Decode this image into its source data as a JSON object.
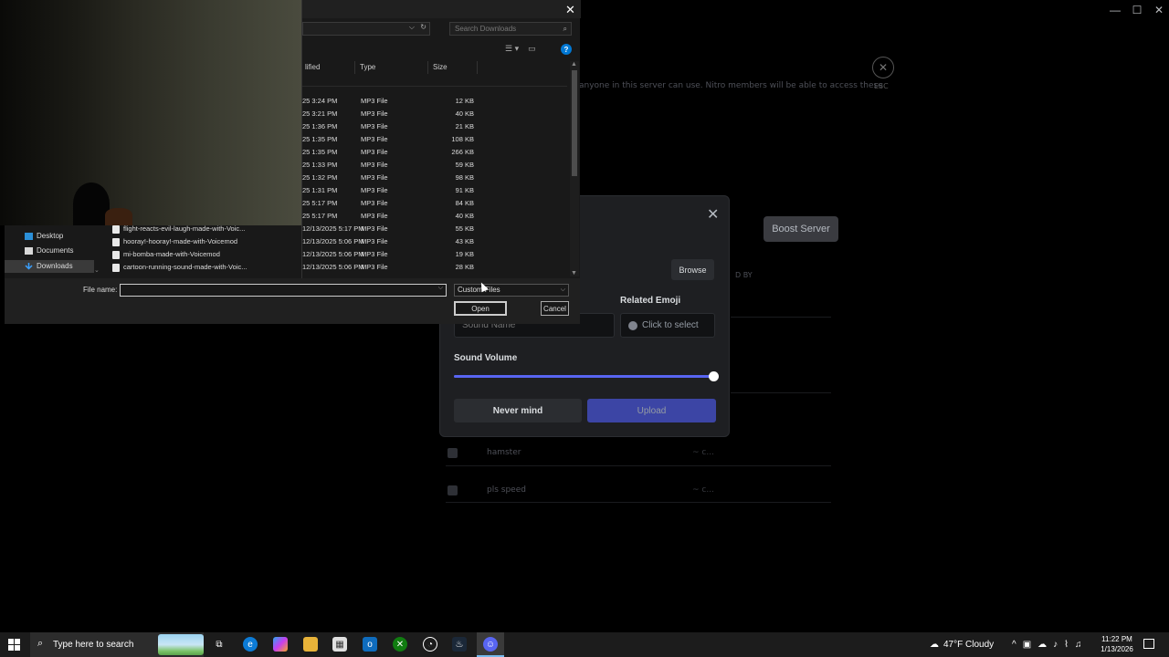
{
  "window_controls": {
    "minimize": "—",
    "maximize": "☐",
    "close": "✕"
  },
  "discord": {
    "esc_label": "ESC",
    "server_note": "anyone in this server can use. Nitro members will be able to access these",
    "boost_label": "Boost Server",
    "by_label": "D BY",
    "sounds": [
      {
        "name": "hamster",
        "author": "~ c..."
      },
      {
        "name": "pls speed",
        "author": "~ c..."
      }
    ]
  },
  "modal": {
    "browse_label": "Browse",
    "emoji_label": "Related Emoji",
    "emoji_placeholder": "Click to select",
    "name_placeholder": "Sound Name",
    "volume_label": "Sound Volume",
    "volume_fraction": 1.0,
    "cancel_label": "Never mind",
    "upload_label": "Upload",
    "accent_color": "#5865f2"
  },
  "dialog": {
    "search_placeholder": "Search Downloads",
    "columns": [
      "lified",
      "Type",
      "Size"
    ],
    "rows": [
      {
        "date": "25 3:24 PM",
        "type": "MP3 File",
        "size": "12 KB"
      },
      {
        "date": "25 3:21 PM",
        "type": "MP3 File",
        "size": "40 KB"
      },
      {
        "date": "25 1:36 PM",
        "type": "MP3 File",
        "size": "21 KB"
      },
      {
        "date": "25 1:35 PM",
        "type": "MP3 File",
        "size": "108 KB"
      },
      {
        "date": "25 1:35 PM",
        "type": "MP3 File",
        "size": "266 KB"
      },
      {
        "date": "25 1:33 PM",
        "type": "MP3 File",
        "size": "59 KB"
      },
      {
        "date": "25 1:32 PM",
        "type": "MP3 File",
        "size": "98 KB"
      },
      {
        "date": "25 1:31 PM",
        "type": "MP3 File",
        "size": "91 KB"
      },
      {
        "date": "25 5:17 PM",
        "type": "MP3 File",
        "size": "84 KB"
      },
      {
        "date": "25 5:17 PM",
        "type": "MP3 File",
        "size": "40 KB"
      },
      {
        "date": "12/13/2025 5:17 PM",
        "type": "MP3 File",
        "size": "55 KB"
      },
      {
        "date": "12/13/2025 5:06 PM",
        "type": "MP3 File",
        "size": "43 KB"
      },
      {
        "date": "12/13/2025 5:06 PM",
        "type": "MP3 File",
        "size": "19 KB"
      },
      {
        "date": "12/13/2025 5:06 PM",
        "type": "MP3 File",
        "size": "28 KB"
      }
    ],
    "visible_names": [
      "flight-reacts-evil-laugh-made-with-Voic...",
      "hooray!-hooray!-made-with-Voicemod",
      "mi-bomba-made-with-Voicemod",
      "cartoon-running-sound-made-with-Voic..."
    ],
    "nav": [
      "Desktop",
      "Documents",
      "Downloads"
    ],
    "file_name_label": "File name:",
    "file_name_value": "",
    "file_type": "Custom Files",
    "open_label": "Open",
    "cancel_label": "Cancel"
  },
  "taskbar": {
    "search_placeholder": "Type here to search",
    "weather": "47°F  Cloudy",
    "time": "11:22 PM",
    "date": "1/13/2026"
  }
}
